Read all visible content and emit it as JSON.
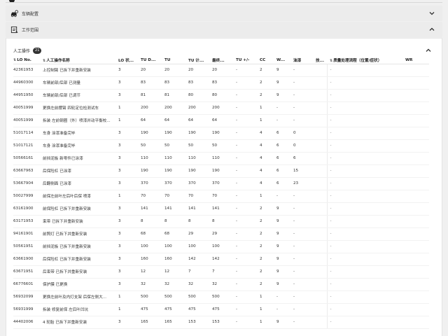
{
  "sections": {
    "vehicle_config": {
      "label": "车辆配置",
      "icon": "car-gear-icon"
    },
    "work_scope": {
      "label": "工作范围",
      "icon": "clipboard-icon"
    }
  },
  "manual_ops": {
    "title": "人工操作",
    "count": "21",
    "columns": [
      "LO No.",
      "人工操作名称",
      "LO 状...",
      "TU D...",
      "TU",
      "TU 计...",
      "最终...",
      "TU +/-",
      "CC",
      "W...",
      "油漆",
      "技...",
      "质量处理流程（位置/症状）",
      "WR"
    ],
    "rows": [
      [
        "42361953",
        "上控制臂 已拆下并重新安装",
        "3",
        "20",
        "20",
        "20",
        "20",
        "-",
        "2",
        "9",
        "-",
        "",
        "-"
      ],
      [
        "44960300",
        "车辆前部/后部 已测量",
        "3",
        "83",
        "83",
        "83",
        "83",
        "-",
        "2",
        "9",
        "-",
        "",
        "-"
      ],
      [
        "44951950",
        "车辆前部/后部 已调节",
        "3",
        "81",
        "81",
        "80",
        "80",
        "-",
        "2",
        "9",
        "-",
        "",
        "-"
      ],
      [
        "40051999",
        "更换左前摆臂 四轮定位检测试车",
        "1",
        "200",
        "200",
        "200",
        "200",
        "-",
        "1",
        "-",
        "-",
        "",
        "-"
      ],
      [
        "40051999",
        "拆装 左前钢圈（外）喷漆并动平衡校...",
        "1",
        "64",
        "64",
        "64",
        "64",
        "-",
        "1",
        "-",
        "-",
        "",
        "-"
      ],
      [
        "51017114",
        "车身 涂漆准备完毕",
        "3",
        "190",
        "190",
        "190",
        "190",
        "-",
        "4",
        "6",
        "0",
        "",
        "-"
      ],
      [
        "51017121",
        "车身 涂漆准备完毕",
        "3",
        "50",
        "50",
        "50",
        "50",
        "-",
        "4",
        "6",
        "0",
        "",
        "-"
      ],
      [
        "50566161",
        "前挡泥板 新零件已涂漆",
        "3",
        "110",
        "110",
        "110",
        "110",
        "-",
        "4",
        "6",
        "6",
        "",
        "-"
      ],
      [
        "63667963",
        "后保险杠 已涂漆",
        "3",
        "190",
        "190",
        "190",
        "190",
        "-",
        "4",
        "6",
        "15",
        "",
        "-"
      ],
      [
        "53667904",
        "后翻侧面 已涂漆",
        "3",
        "370",
        "370",
        "370",
        "370",
        "-",
        "4",
        "6",
        "23",
        "",
        "-"
      ],
      [
        "50027999",
        "前保左前叶左后叶后保 喷漆",
        "1",
        "70",
        "70",
        "70",
        "70",
        "-",
        "1",
        "-",
        "-",
        "",
        "-"
      ],
      [
        "63161900",
        "前保险杠 已拆下并重新安装",
        "3",
        "141",
        "141",
        "141",
        "141",
        "-",
        "2",
        "9",
        "-",
        "",
        "-"
      ],
      [
        "63171953",
        "束带 已拆下并重新安装",
        "3",
        "8",
        "8",
        "8",
        "8",
        "-",
        "2",
        "9",
        "-",
        "",
        "-"
      ],
      [
        "94161901",
        "前照灯 已拆下并重新安装",
        "3",
        "68",
        "68",
        "29",
        "29",
        "-",
        "2",
        "9",
        "-",
        "",
        "-"
      ],
      [
        "50561951",
        "前挡泥板 已拆下并重新安装",
        "3",
        "100",
        "100",
        "100",
        "100",
        "-",
        "2",
        "9",
        "-",
        "",
        "-"
      ],
      [
        "63661900",
        "后保险杠 已拆下并重新安装",
        "3",
        "160",
        "160",
        "142",
        "142",
        "-",
        "2",
        "9",
        "-",
        "",
        "-"
      ],
      [
        "63671951",
        "后束带 已拆下并重新安装",
        "3",
        "12",
        "12",
        "7",
        "7",
        "-",
        "2",
        "9",
        "-",
        "",
        "-"
      ],
      [
        "66776601",
        "保护膜 已更换",
        "3",
        "32",
        "32",
        "32",
        "32",
        "-",
        "2",
        "9",
        "-",
        "",
        "-"
      ],
      [
        "56932099",
        "更换左前叶及内灯支架 后保左侧大...",
        "1",
        "500",
        "500",
        "500",
        "500",
        "-",
        "1",
        "-",
        "-",
        "",
        "-"
      ],
      [
        "56931999",
        "拆装 修复前保 左后叶凹坑",
        "1",
        "475",
        "475",
        "475",
        "475",
        "-",
        "1",
        "-",
        "-",
        "",
        "-"
      ],
      [
        "44402006",
        "4 轮胎 已拆下并重新安装",
        "3",
        "165",
        "165",
        "153",
        "153",
        "-",
        "1",
        "9",
        "-",
        "",
        "-"
      ]
    ]
  }
}
